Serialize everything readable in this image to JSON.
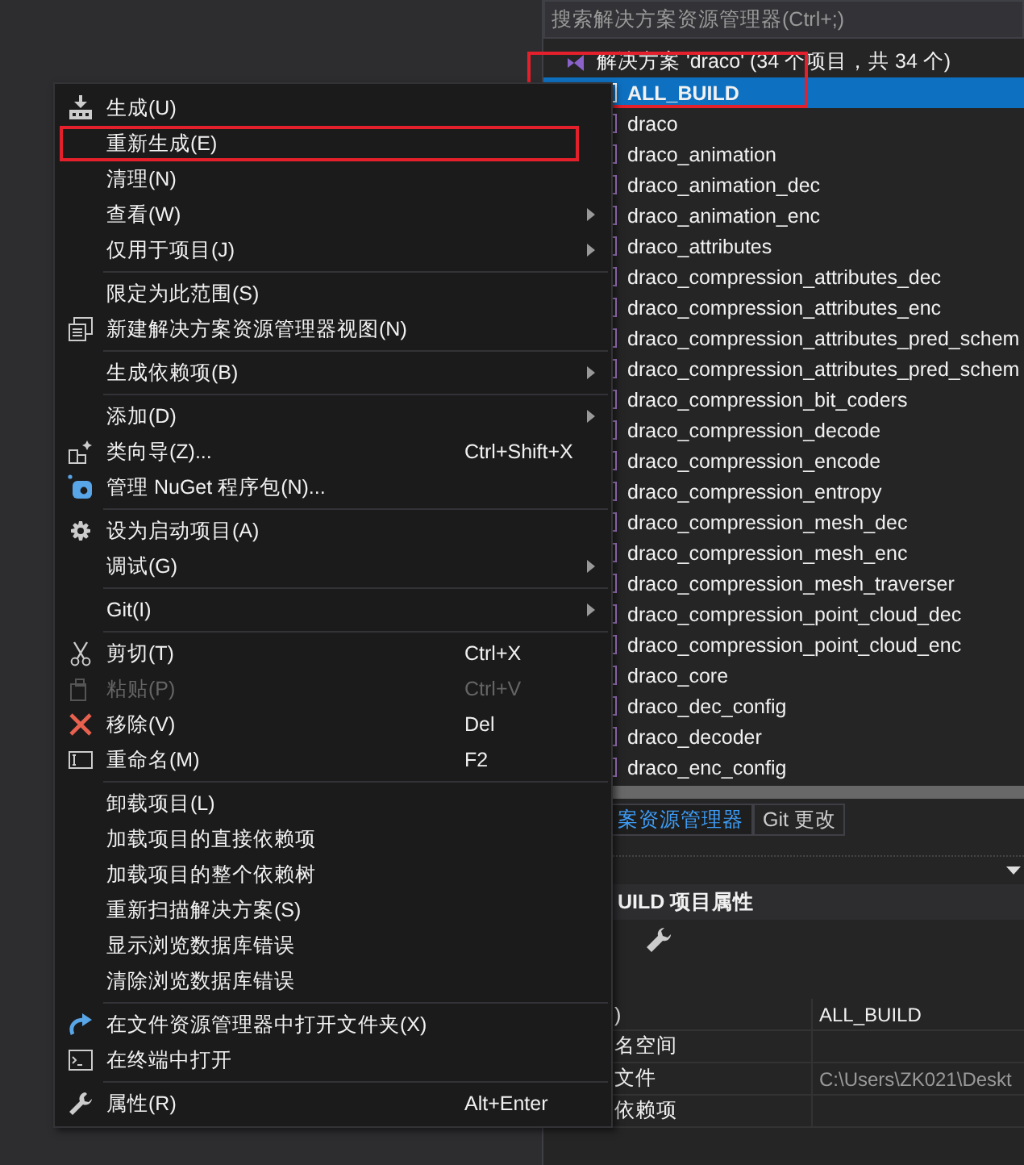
{
  "search": {
    "placeholder": "搜索解决方案资源管理器(Ctrl+;)"
  },
  "solution": {
    "label": "解决方案 'draco' (34 个项目，共 34 个)"
  },
  "projects": [
    {
      "label": "ALL_BUILD",
      "selected": true
    },
    {
      "label": "draco",
      "selected": false
    },
    {
      "label": "draco_animation",
      "selected": false
    },
    {
      "label": "draco_animation_dec",
      "selected": false
    },
    {
      "label": "draco_animation_enc",
      "selected": false
    },
    {
      "label": "draco_attributes",
      "selected": false
    },
    {
      "label": "draco_compression_attributes_dec",
      "selected": false
    },
    {
      "label": "draco_compression_attributes_enc",
      "selected": false
    },
    {
      "label": "draco_compression_attributes_pred_schem",
      "selected": false
    },
    {
      "label": "draco_compression_attributes_pred_schem",
      "selected": false
    },
    {
      "label": "draco_compression_bit_coders",
      "selected": false
    },
    {
      "label": "draco_compression_decode",
      "selected": false
    },
    {
      "label": "draco_compression_encode",
      "selected": false
    },
    {
      "label": "draco_compression_entropy",
      "selected": false
    },
    {
      "label": "draco_compression_mesh_dec",
      "selected": false
    },
    {
      "label": "draco_compression_mesh_enc",
      "selected": false
    },
    {
      "label": "draco_compression_mesh_traverser",
      "selected": false
    },
    {
      "label": "draco_compression_point_cloud_dec",
      "selected": false
    },
    {
      "label": "draco_compression_point_cloud_enc",
      "selected": false
    },
    {
      "label": "draco_core",
      "selected": false
    },
    {
      "label": "draco_dec_config",
      "selected": false
    },
    {
      "label": "draco_decoder",
      "selected": false
    },
    {
      "label": "draco_enc_config",
      "selected": false
    }
  ],
  "tabs": [
    {
      "label": "案资源管理器",
      "selected": true
    },
    {
      "label": "Git 更改",
      "selected": false
    }
  ],
  "properties": {
    "title": "UILD 项目属性",
    "rows": [
      {
        "name": ")",
        "value": "ALL_BUILD",
        "dim": false
      },
      {
        "name": "名空间"
      },
      {
        "name": "文件",
        "value": "C:\\Users\\ZK021\\Deskt",
        "dim": true
      },
      {
        "name": "依赖项"
      }
    ]
  },
  "menu": {
    "groups": [
      [
        {
          "label": "生成(U)",
          "submenu": false,
          "disabled": false,
          "highlighted": false
        },
        {
          "label": "重新生成(E)",
          "submenu": false,
          "disabled": false,
          "highlighted": true
        },
        {
          "label": "清理(N)",
          "submenu": false,
          "disabled": false,
          "highlighted": false
        },
        {
          "label": "查看(W)",
          "submenu": true,
          "disabled": false,
          "highlighted": false
        },
        {
          "label": "仅用于项目(J)",
          "submenu": true,
          "disabled": false,
          "highlighted": false
        }
      ],
      [
        {
          "label": "限定为此范围(S)",
          "submenu": false,
          "disabled": false,
          "highlighted": false
        },
        {
          "label": "新建解决方案资源管理器视图(N)",
          "submenu": false,
          "disabled": false,
          "highlighted": false
        }
      ],
      [
        {
          "label": "生成依赖项(B)",
          "submenu": true,
          "disabled": false,
          "highlighted": false
        }
      ],
      [
        {
          "label": "添加(D)",
          "submenu": true,
          "disabled": false,
          "highlighted": false
        },
        {
          "label": "类向导(Z)...",
          "shortcut": "Ctrl+Shift+X",
          "submenu": false,
          "disabled": false,
          "highlighted": false
        },
        {
          "label": "管理 NuGet 程序包(N)...",
          "submenu": false,
          "disabled": false,
          "highlighted": false
        }
      ],
      [
        {
          "label": "设为启动项目(A)",
          "submenu": false,
          "disabled": false,
          "highlighted": false
        },
        {
          "label": "调试(G)",
          "submenu": true,
          "disabled": false,
          "highlighted": false
        }
      ],
      [
        {
          "label": "Git(I)",
          "submenu": true,
          "disabled": false,
          "highlighted": false
        }
      ],
      [
        {
          "label": "剪切(T)",
          "shortcut": "Ctrl+X",
          "submenu": false,
          "disabled": false,
          "highlighted": false
        },
        {
          "label": "粘贴(P)",
          "shortcut": "Ctrl+V",
          "submenu": false,
          "disabled": true,
          "highlighted": false
        },
        {
          "label": "移除(V)",
          "shortcut": "Del",
          "submenu": false,
          "disabled": false,
          "highlighted": false
        },
        {
          "label": "重命名(M)",
          "shortcut": "F2",
          "submenu": false,
          "disabled": false,
          "highlighted": false
        }
      ],
      [
        {
          "label": "卸载项目(L)",
          "submenu": false,
          "disabled": false,
          "highlighted": false
        },
        {
          "label": "加载项目的直接依赖项",
          "submenu": false,
          "disabled": false,
          "highlighted": false
        },
        {
          "label": "加载项目的整个依赖树",
          "submenu": false,
          "disabled": false,
          "highlighted": false
        },
        {
          "label": "重新扫描解决方案(S)",
          "submenu": false,
          "disabled": false,
          "highlighted": false
        },
        {
          "label": "显示浏览数据库错误",
          "submenu": false,
          "disabled": false,
          "highlighted": false
        },
        {
          "label": "清除浏览数据库错误",
          "submenu": false,
          "disabled": false,
          "highlighted": false
        }
      ],
      [
        {
          "label": "在文件资源管理器中打开文件夹(X)",
          "submenu": false,
          "disabled": false,
          "highlighted": false
        },
        {
          "label": "在终端中打开",
          "submenu": false,
          "disabled": false,
          "highlighted": false
        }
      ],
      [
        {
          "label": "属性(R)",
          "shortcut": "Alt+Enter",
          "submenu": false,
          "disabled": false,
          "highlighted": false
        }
      ]
    ]
  }
}
